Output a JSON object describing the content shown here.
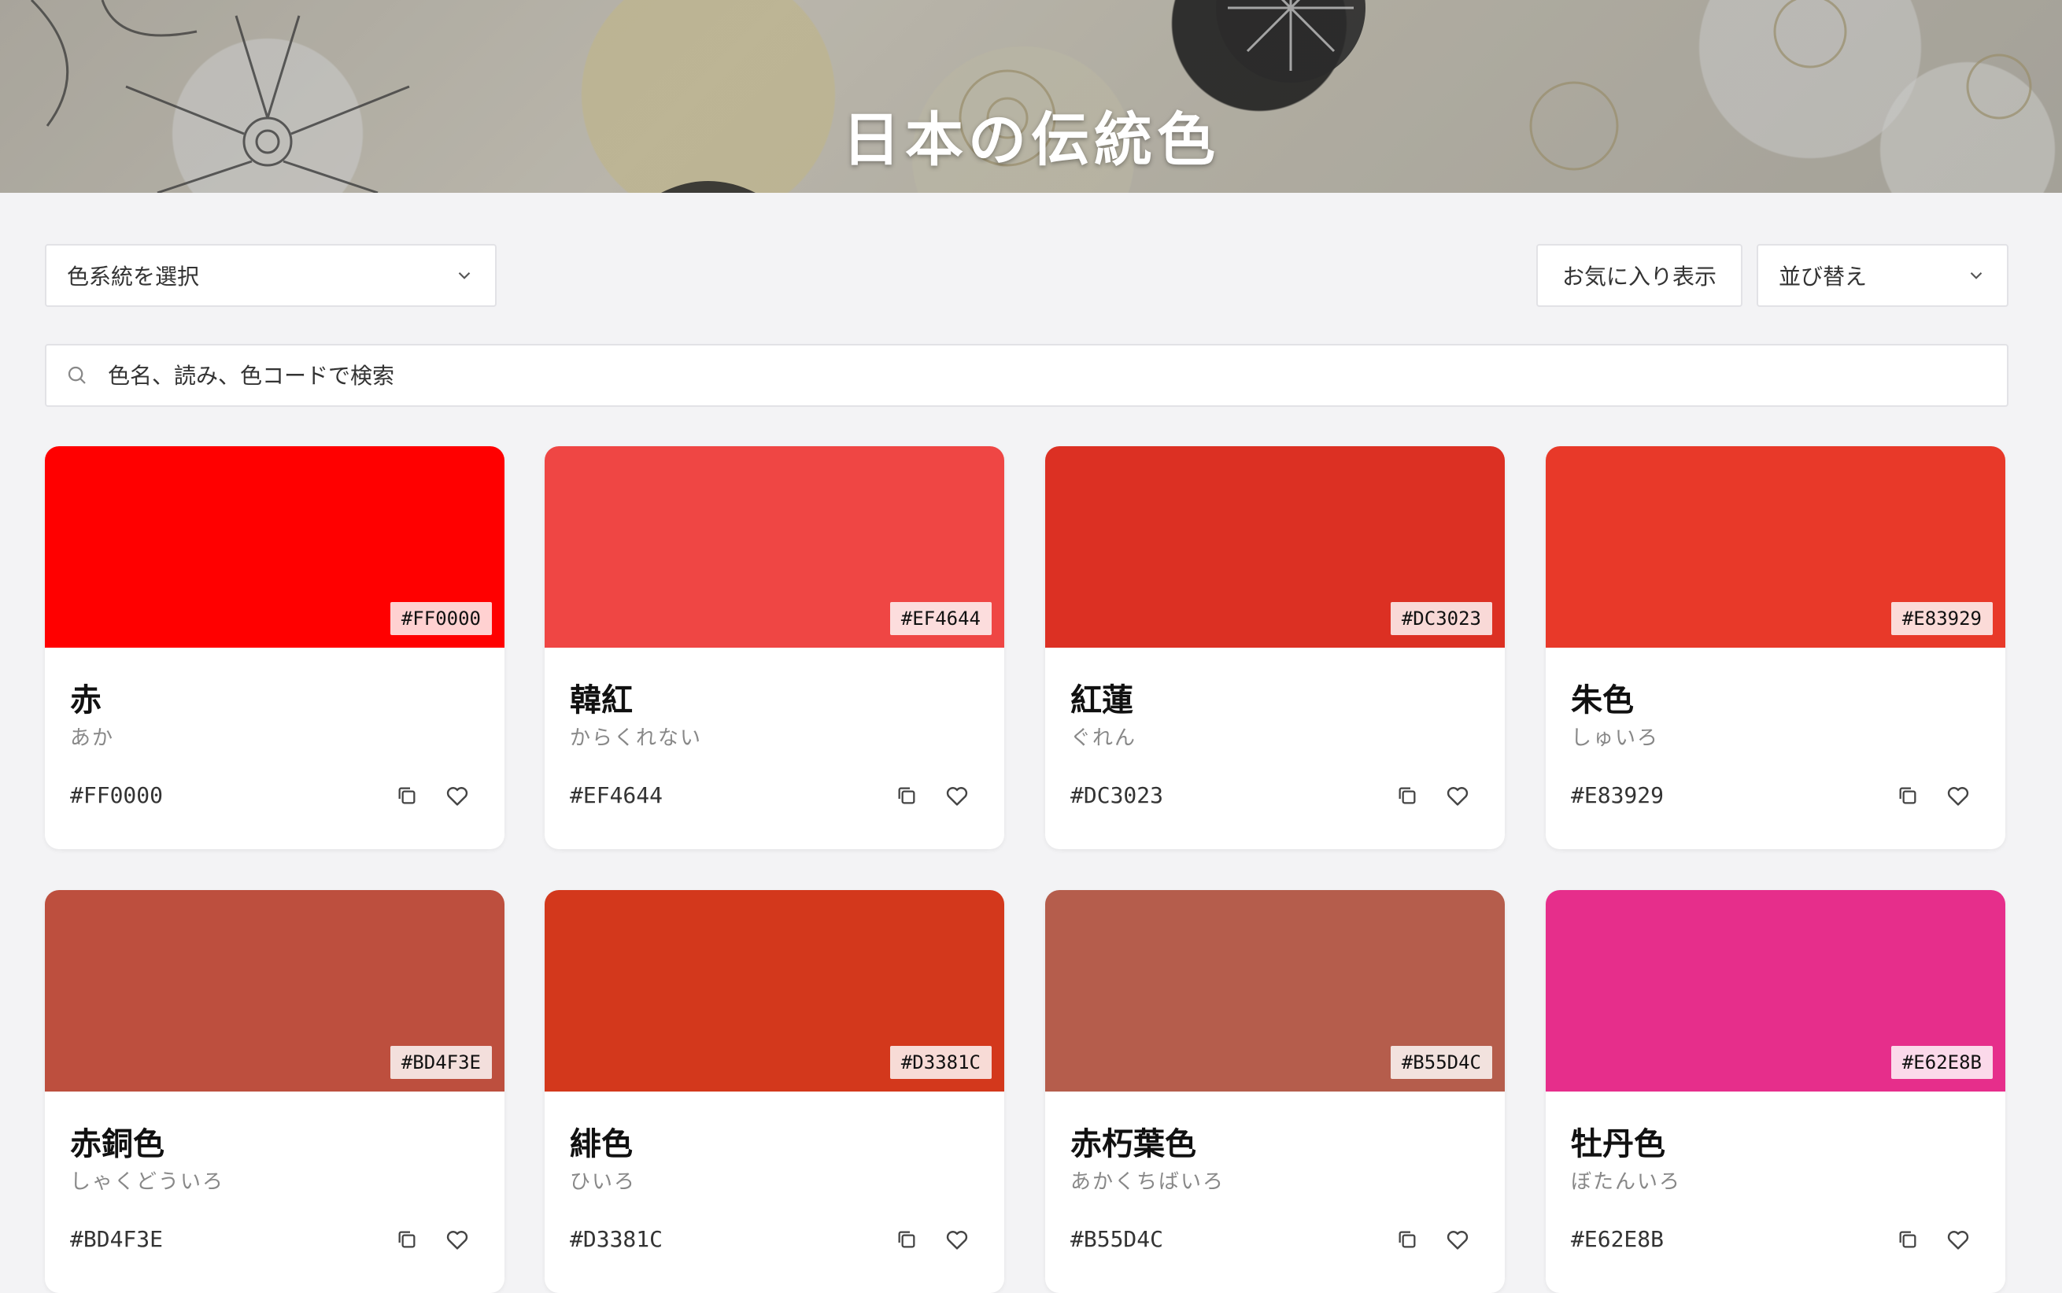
{
  "header": {
    "title": "日本の伝統色"
  },
  "filters": {
    "family_select": "色系統を選択",
    "favorites_button": "お気に入り表示",
    "sort_select": "並び替え"
  },
  "search": {
    "placeholder": "色名、読み、色コードで検索"
  },
  "icons": {
    "search": "search-icon",
    "dropdown": "chevron-down-icon",
    "copy": "copy-icon",
    "favorite": "heart-icon"
  },
  "colors": [
    {
      "name": "赤",
      "reading": "あか",
      "hex": "#FF0000"
    },
    {
      "name": "韓紅",
      "reading": "からくれない",
      "hex": "#EF4644"
    },
    {
      "name": "紅蓮",
      "reading": "ぐれん",
      "hex": "#DC3023"
    },
    {
      "name": "朱色",
      "reading": "しゅいろ",
      "hex": "#E83929"
    },
    {
      "name": "赤銅色",
      "reading": "しゃくどういろ",
      "hex": "#BD4F3E"
    },
    {
      "name": "緋色",
      "reading": "ひいろ",
      "hex": "#D3381C"
    },
    {
      "name": "赤朽葉色",
      "reading": "あかくちばいろ",
      "hex": "#B55D4C"
    },
    {
      "name": "牡丹色",
      "reading": "ぼたんいろ",
      "hex": "#E62E8B"
    }
  ]
}
